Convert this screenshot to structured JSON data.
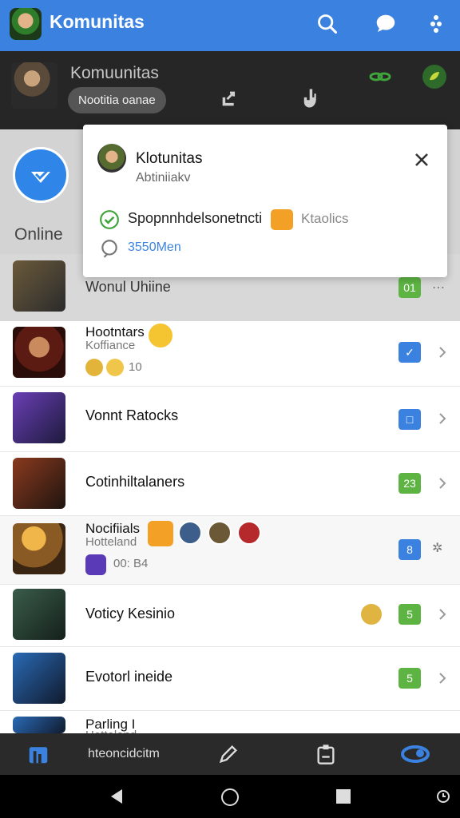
{
  "app_bar": {
    "title": "Komunitas"
  },
  "header": {
    "title": "Komuunitas",
    "pill": "Nootitia oanae"
  },
  "popup": {
    "title": "Klotunitas",
    "subtitle": "Abtiniiakv",
    "row1_text": "Spopnnhdelsonetncti",
    "row1_extra": "Ktaolics",
    "row2_text": "3550Men"
  },
  "online_label": "Online",
  "list": [
    {
      "title": "Wonul Uhiine",
      "badge": "01",
      "badge_color": "#5db443"
    },
    {
      "title": "Hootntars",
      "subtitle": "Koffiance",
      "meta": "10",
      "badge": "✓",
      "badge_color": "#3b82e0"
    },
    {
      "title": "Vonnt Ratocks",
      "badge": "□",
      "badge_color": "#3b82e0"
    },
    {
      "title": "Cotinhiltalaners",
      "badge": "23",
      "badge_color": "#5db443"
    },
    {
      "title": "Nocifiials",
      "subtitle": "Hotteland",
      "meta": "00: B4",
      "badge": "8",
      "badge_color": "#3b82e0"
    },
    {
      "title": "Voticy Kesinio",
      "badge": "5",
      "badge_color": "#5db443"
    },
    {
      "title": "Evotorl ineide",
      "badge": "5",
      "badge_color": "#5db443"
    },
    {
      "title": "Parling I",
      "subtitle": "Hotteland"
    }
  ],
  "bottom_nav": {
    "center_label": "hteoncidcitm"
  },
  "colors": {
    "brand_blue": "#3b82e0",
    "green": "#5db443",
    "dark": "#262626"
  }
}
